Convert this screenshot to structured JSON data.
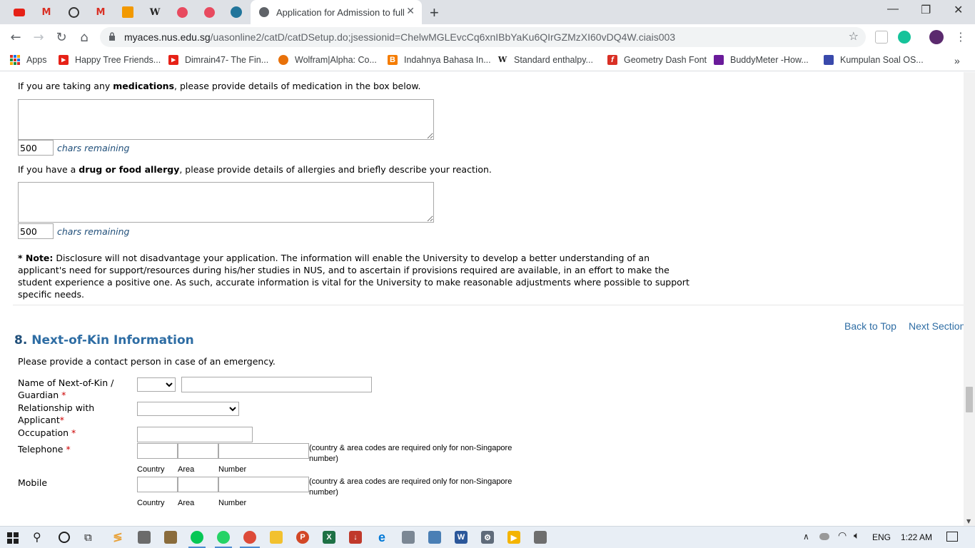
{
  "browser": {
    "active_tab_title": "Application for Admission to full",
    "url_host": "myaces.nus.edu.sg",
    "url_path": "/uasonline2/catD/catDSetup.do;jsessionid=ChelwMGLEvcCq6xnIBbYaKu6QIrGZMzXI60vDQ4W.ciais003",
    "bookmarks": [
      {
        "label": "Apps"
      },
      {
        "label": "Happy Tree Friends..."
      },
      {
        "label": "Dimrain47- The Fin..."
      },
      {
        "label": "Wolfram|Alpha: Co..."
      },
      {
        "label": "Indahnya Bahasa In..."
      },
      {
        "label": "Standard enthalpy..."
      },
      {
        "label": "Geometry Dash Font"
      },
      {
        "label": "BuddyMeter -How..."
      },
      {
        "label": "Kumpulan Soal OS..."
      }
    ]
  },
  "form": {
    "medications": {
      "prefix": "If you are taking any ",
      "bold": "medications",
      "suffix": ", please provide details of medication in the box below.",
      "counter": "500",
      "remaining_label": "chars remaining"
    },
    "allergy": {
      "prefix": "If you have a ",
      "bold": "drug or food allergy",
      "suffix": ", please provide details of allergies and briefly describe your reaction.",
      "counter": "500",
      "remaining_label": "chars remaining"
    },
    "note": {
      "label": "* Note:",
      "text": " Disclosure will not disadvantage your application. The information will enable the University to develop a better understanding of an applicant's need for support/resources during his/her studies in NUS, and to ascertain if provisions required are available, in an effort to make the student experience a positive one. As such, accurate information is vital for the University to make reasonable adjustments where possible to support specific needs."
    },
    "section": {
      "number": "8.",
      "title": "Next-of-Kin Information",
      "back_to_top": "Back to Top",
      "next_section": "Next Section",
      "intro": "Please provide a contact person in case of an emergency."
    },
    "fields": {
      "name_label": "Name of Next-of-Kin / Guardian",
      "relationship_label": "Relationship with Applicant",
      "occupation_label": "Occupation",
      "telephone_label": "Telephone",
      "mobile_label": "Mobile",
      "required_mark": "*",
      "phone_hint": "(country & area codes are required only for non-Singapore number)",
      "country_label": "Country",
      "area_label": "Area",
      "number_label": "Number"
    }
  },
  "taskbar": {
    "language": "ENG",
    "time": "1:22 AM"
  }
}
